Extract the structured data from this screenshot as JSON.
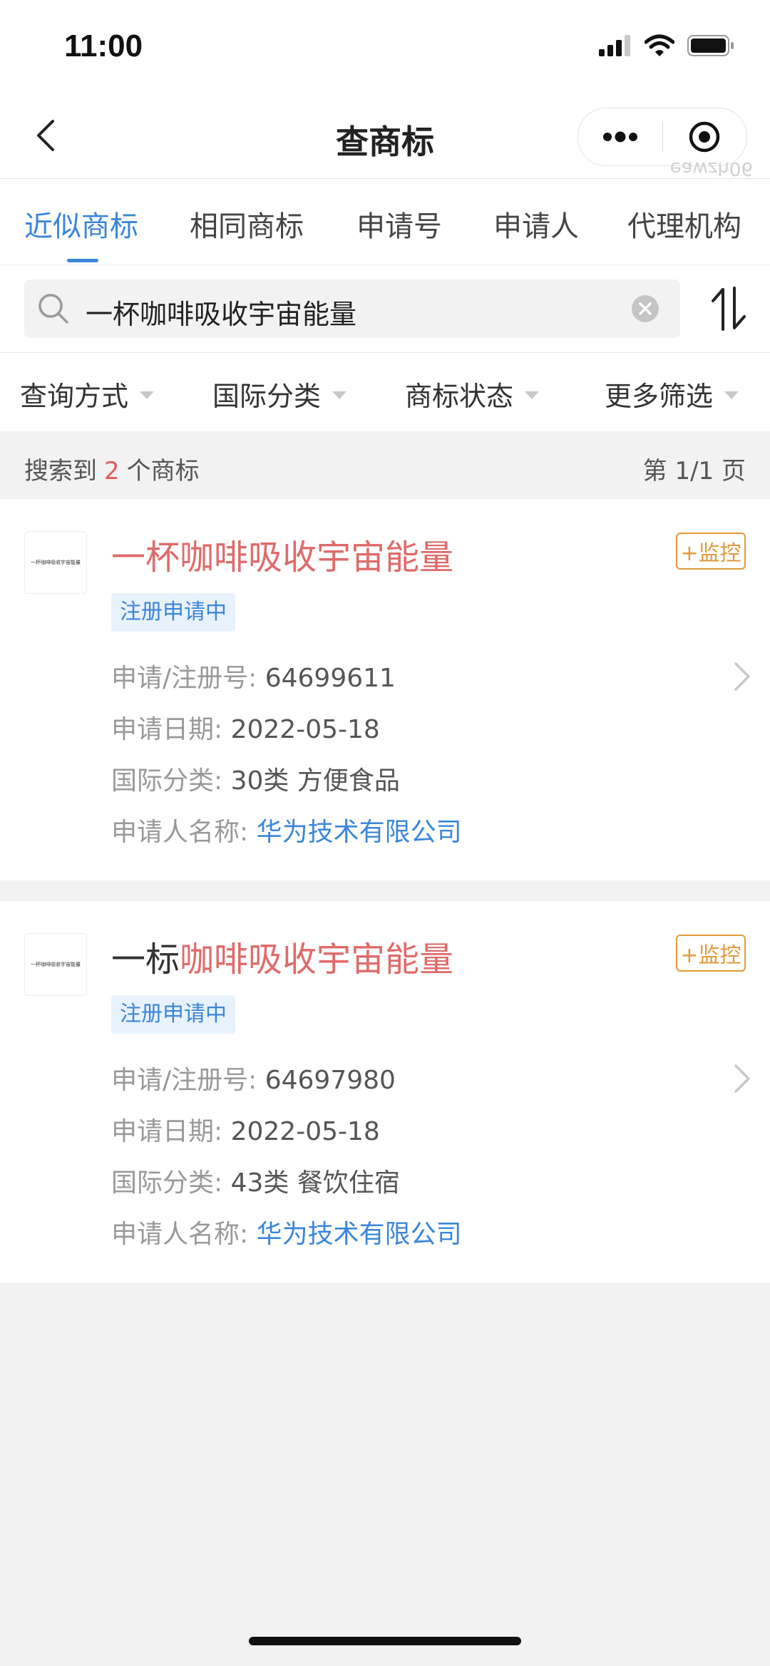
{
  "status_bar": {
    "time": "11:00"
  },
  "nav": {
    "title": "查商标",
    "watermark": "eawzh06"
  },
  "tabs": [
    {
      "label": "近似商标",
      "active": true
    },
    {
      "label": "相同商标",
      "active": false
    },
    {
      "label": "申请号",
      "active": false
    },
    {
      "label": "申请人",
      "active": false
    },
    {
      "label": "代理机构",
      "active": false
    }
  ],
  "search": {
    "value": "一杯咖啡吸收宇宙能量"
  },
  "filters": [
    "查询方式",
    "国际分类",
    "商标状态",
    "更多筛选"
  ],
  "results": {
    "prefix": "搜索到",
    "count": "2",
    "suffix": "个商标",
    "page": "第 1/1 页"
  },
  "cards": [
    {
      "thumb_text": "一杯咖啡吸收宇宙能量",
      "name_plain": "",
      "name_highlight": "一杯咖啡吸收宇宙能量",
      "monitor": "+监控",
      "status": "注册申请中",
      "labels": {
        "reg_no": "申请/注册号:",
        "date": "申请日期:",
        "class": "国际分类:",
        "applicant": "申请人名称:"
      },
      "reg_no": "64699611",
      "date": "2022-05-18",
      "class": "30类 方便食品",
      "applicant": "华为技术有限公司"
    },
    {
      "thumb_text": "一杯咖啡吸收宇宙能量",
      "name_plain": "一标",
      "name_highlight": "咖啡吸收宇宙能量",
      "monitor": "+监控",
      "status": "注册申请中",
      "labels": {
        "reg_no": "申请/注册号:",
        "date": "申请日期:",
        "class": "国际分类:",
        "applicant": "申请人名称:"
      },
      "reg_no": "64697980",
      "date": "2022-05-18",
      "class": "43类 餐饮住宿",
      "applicant": "华为技术有限公司"
    }
  ],
  "colors": {
    "accent": "#3b86d8",
    "highlight": "#e06a6a",
    "monitor": "#e39a3a"
  }
}
